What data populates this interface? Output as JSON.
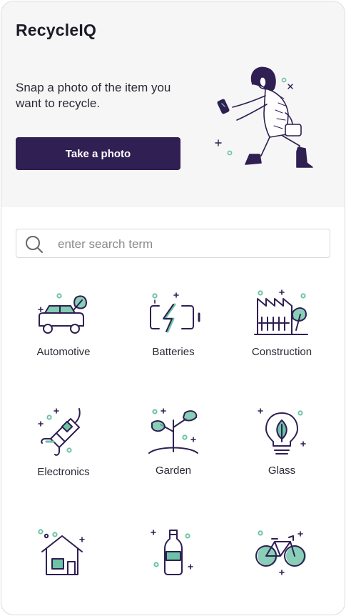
{
  "app": {
    "title": "RecycleIQ"
  },
  "hero": {
    "tagline": "Snap a photo of the item you want to recycle.",
    "button_label": "Take a photo"
  },
  "search": {
    "placeholder": "enter search term",
    "value": ""
  },
  "colors": {
    "primary": "#2f1f53",
    "accent": "#6cc3a5",
    "hero_bg": "#f6f6f6"
  },
  "categories": [
    {
      "label": "Automotive",
      "icon": "car-leaf-icon"
    },
    {
      "label": "Batteries",
      "icon": "battery-icon"
    },
    {
      "label": "Construction",
      "icon": "factory-icon"
    },
    {
      "label": "Electronics",
      "icon": "plug-icon"
    },
    {
      "label": "Garden",
      "icon": "plant-icon"
    },
    {
      "label": "Glass",
      "icon": "lightbulb-icon"
    },
    {
      "label": "",
      "icon": "house-icon"
    },
    {
      "label": "",
      "icon": "bottle-icon"
    },
    {
      "label": "",
      "icon": "bicycle-icon"
    }
  ]
}
